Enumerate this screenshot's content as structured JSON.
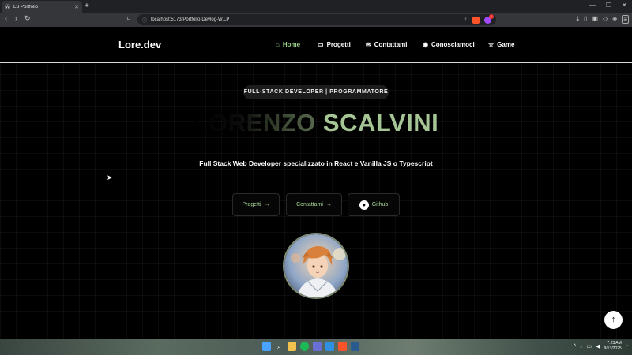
{
  "browser": {
    "tab_title": "LS Portfolio",
    "tab_favicon": "Ⓦ",
    "url": "localhost:5173/Portfolio-Devlog-W.LP",
    "rewards_count": "1"
  },
  "nav": {
    "brand": "Lore.dev",
    "items": [
      {
        "label": "Home",
        "icon": "home-icon",
        "active": true
      },
      {
        "label": "Progetti",
        "icon": "folder-icon"
      },
      {
        "label": "Contattami",
        "icon": "mail-icon"
      },
      {
        "label": "Conosciamoci",
        "icon": "user-circle-icon"
      },
      {
        "label": "Game",
        "icon": "star-icon"
      }
    ]
  },
  "hero": {
    "badge": "FULL-STACK DEVELOPER | PROGRAMMATORE",
    "name_faded": "LORENZO ",
    "name_solid": "SCALVINI",
    "subtitle": "Full Stack Web Developer specializzato in React e Vanilla JS o Typescript",
    "buttons": [
      {
        "label": "Progetti",
        "suffix": "→"
      },
      {
        "label": "Contattami",
        "suffix": "→"
      },
      {
        "label": "Github",
        "icon": "github-icon"
      }
    ]
  },
  "colors": {
    "accent_green": "#9ed08a",
    "name_solid": "#a6c595"
  },
  "taskbar": {
    "time": "7:23 AM",
    "date": "9/13/2025"
  }
}
